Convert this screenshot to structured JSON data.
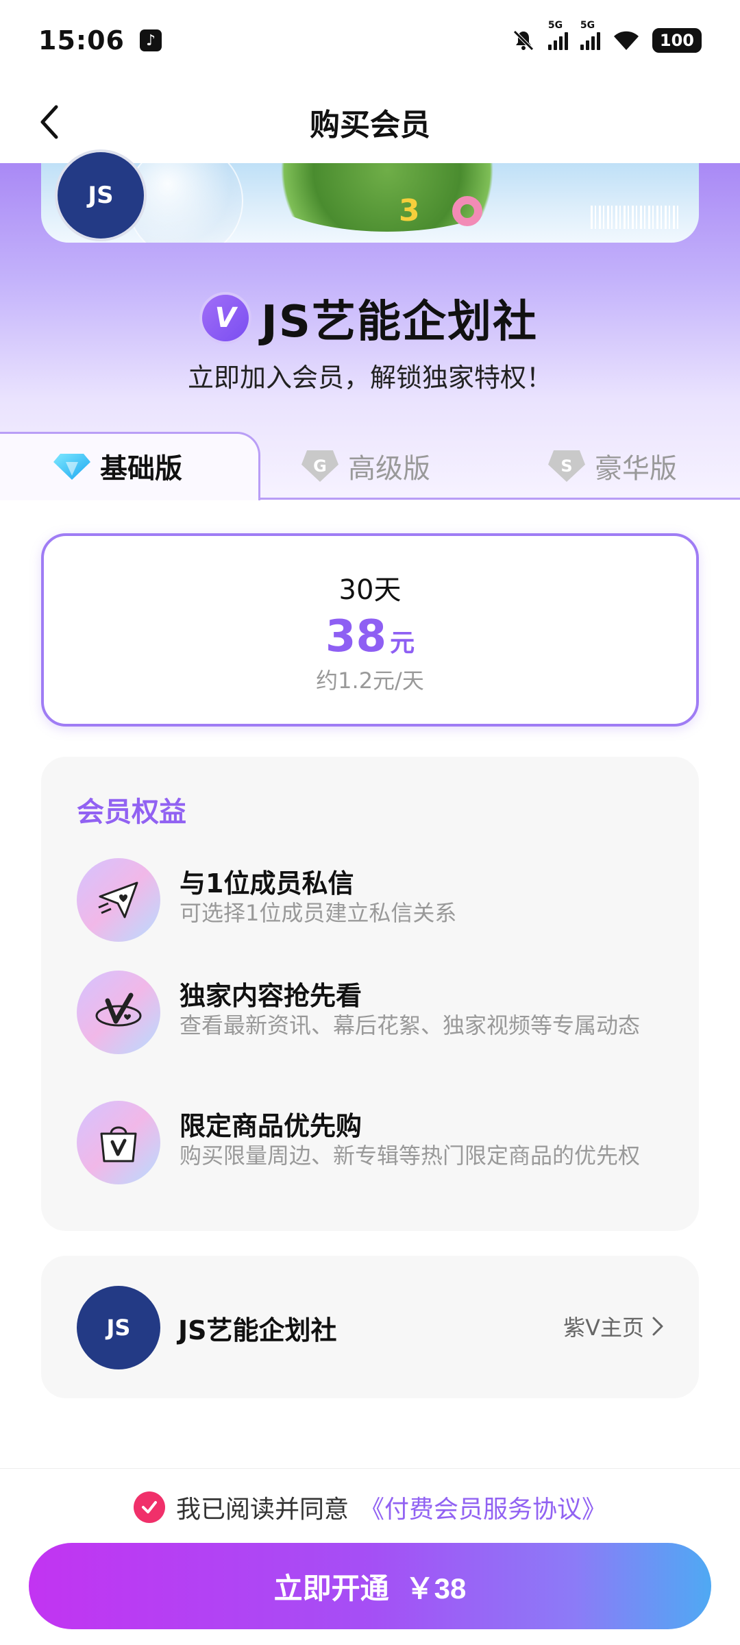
{
  "status_bar": {
    "time": "15:06",
    "network_1": "5G",
    "network_2": "5G",
    "battery": "100"
  },
  "nav": {
    "title": "购买会员"
  },
  "hero": {
    "logo_text": "JS",
    "v_badge": "V",
    "club_name": "JS艺能企划社",
    "subtitle": "立即加入会员，解锁独家特权！"
  },
  "tabs": [
    {
      "label": "基础版",
      "icon": "diamond-icon",
      "active": true
    },
    {
      "label": "高级版",
      "icon": "G",
      "active": false
    },
    {
      "label": "豪华版",
      "icon": "S",
      "active": false
    }
  ],
  "plan": {
    "days": "30天",
    "price": "38",
    "unit": "元",
    "per_day": "约1.2元/天"
  },
  "benefits": {
    "title": "会员权益",
    "items": [
      {
        "icon": "paper-plane-heart-icon",
        "title": "与1位成员私信",
        "desc": "可选择1位成员建立私信关系"
      },
      {
        "icon": "v-ring-icon",
        "title": "独家内容抢先看",
        "desc": "查看最新资讯、幕后花絮、独家视频等专属动态"
      },
      {
        "icon": "shopping-bag-icon",
        "title": "限定商品优先购",
        "desc": "购买限量周边、新专辑等热门限定商品的优先权"
      }
    ]
  },
  "club": {
    "avatar_text": "JS",
    "name": "JS艺能企划社",
    "link": "紫V主页"
  },
  "footer": {
    "agree_prefix": "我已阅读并同意",
    "agree_link": "《付费会员服务协议》",
    "buy_label": "立即开通",
    "buy_price": "￥38"
  },
  "colors": {
    "accent": "#9162f2",
    "check": "#f0306a",
    "logo_bg": "#233a85"
  }
}
